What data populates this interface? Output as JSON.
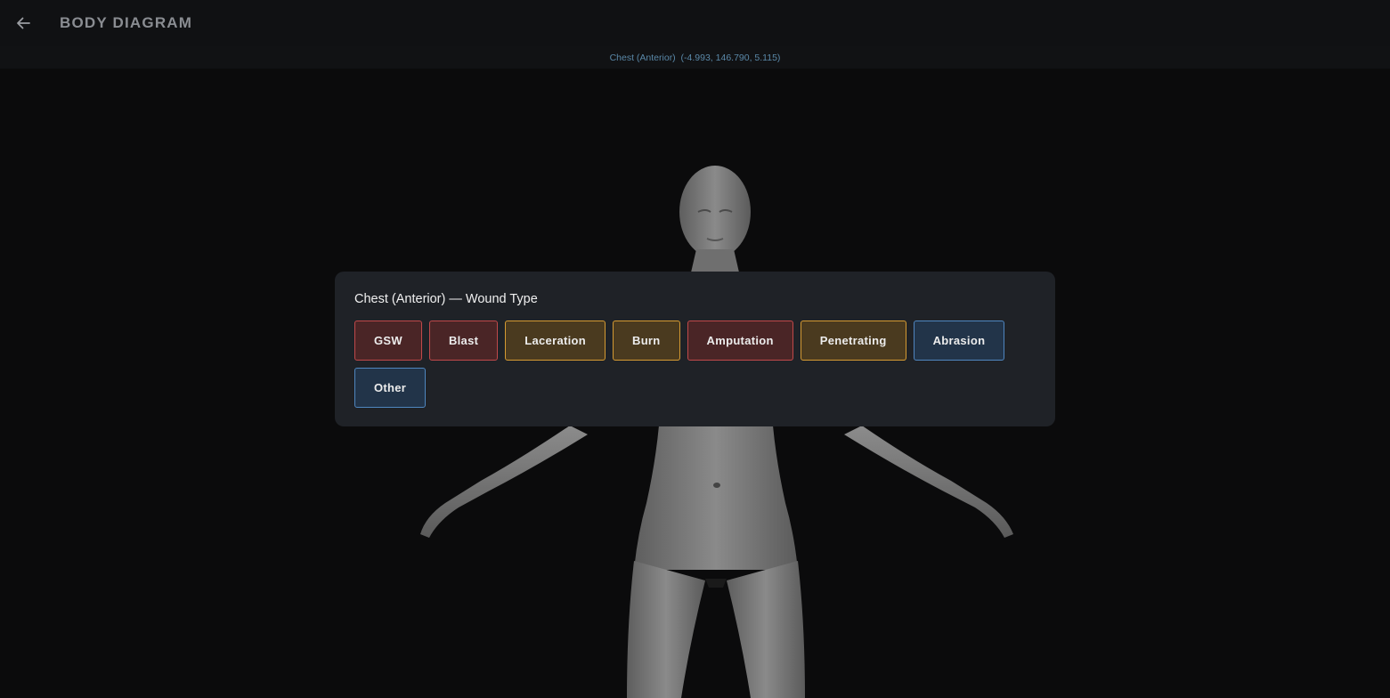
{
  "header": {
    "title": "BODY DIAGRAM",
    "back_icon": "arrow-left-icon"
  },
  "selection": {
    "region": "Chest (Anterior)",
    "coords": "(-4.993, 146.790, 5.115)"
  },
  "wound_panel": {
    "title": "Chest (Anterior) — Wound Type",
    "buttons": [
      {
        "label": "GSW",
        "tone": "red"
      },
      {
        "label": "Blast",
        "tone": "red"
      },
      {
        "label": "Laceration",
        "tone": "amber"
      },
      {
        "label": "Burn",
        "tone": "amber"
      },
      {
        "label": "Amputation",
        "tone": "red"
      },
      {
        "label": "Penetrating",
        "tone": "amber"
      },
      {
        "label": "Abrasion",
        "tone": "blue"
      },
      {
        "label": "Other",
        "tone": "blue"
      }
    ]
  },
  "colors": {
    "red": "#c0494a",
    "amber": "#d59a32",
    "blue": "#4f86bf"
  }
}
